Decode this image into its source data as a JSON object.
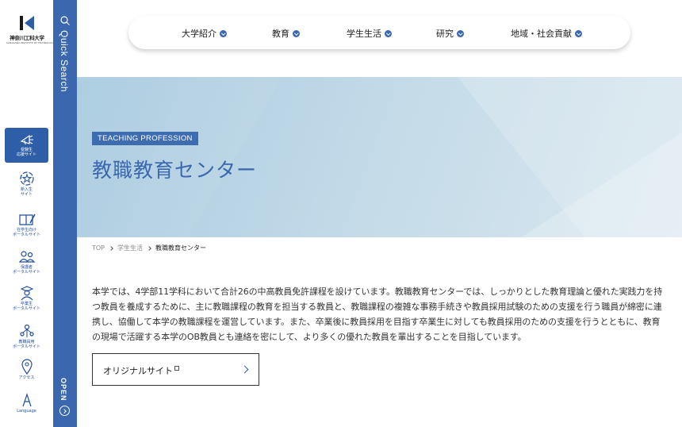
{
  "logo": {
    "name": "神奈川工科大学",
    "sub": "KANAGAWA INSTITUTE OF TECHNOLOGY"
  },
  "sidebar": {
    "items": [
      {
        "label": "受験生\n応援サイト",
        "icon": "megaphone-icon"
      },
      {
        "label": "新入生\nサイト",
        "icon": "flower-icon"
      },
      {
        "label": "在学生向け\nポータルサイト",
        "icon": "book-pencil-icon"
      },
      {
        "label": "保護者\nポータルサイト",
        "icon": "parents-icon"
      },
      {
        "label": "卒業生\nポータルサイト",
        "icon": "graduate-icon"
      },
      {
        "label": "教職員用\nポータルサイト",
        "icon": "staff-network-icon"
      },
      {
        "label": "アクセス",
        "icon": "map-pin-icon"
      },
      {
        "label": "Language",
        "icon": "letter-a-icon"
      }
    ]
  },
  "quick_search": {
    "label": "Quick Search",
    "open_label": "OPEN"
  },
  "nav": {
    "items": [
      {
        "label": "大学紹介"
      },
      {
        "label": "教育"
      },
      {
        "label": "学生生活"
      },
      {
        "label": "研究"
      },
      {
        "label": "地域・社会貢献"
      }
    ]
  },
  "hero": {
    "tag": "TEACHING PROFESSION",
    "title": "教職教育センター"
  },
  "breadcrumb": {
    "items": [
      "TOP",
      "学生生活",
      "教職教育センター"
    ]
  },
  "intro": {
    "text": "本学では、4学部11学科において合計26の中高教員免許課程を設けています。教職教育センターでは、しっかりとした教育理論と優れた実践力を持つ教員を養成するために、主に教職課程の教育を担当する教員と、教職課程の複雑な事務手続きや教員採用試験のための支援を行う職員が綿密に連携し、協働して本学の教職課程を運営しています。また、卒業後に教員採用を目指す卒業生に対しても教員採用のための支援を行うとともに、教育の現場で活躍する本学のOB教員とも連絡を密にして、より多くの優れた教員を輩出することを目指しています。"
  },
  "button": {
    "label": "オリジナルサイト"
  },
  "colors": {
    "primary": "#3a67ae",
    "active": "#2e5ea8",
    "hero": "#c6dce9"
  }
}
